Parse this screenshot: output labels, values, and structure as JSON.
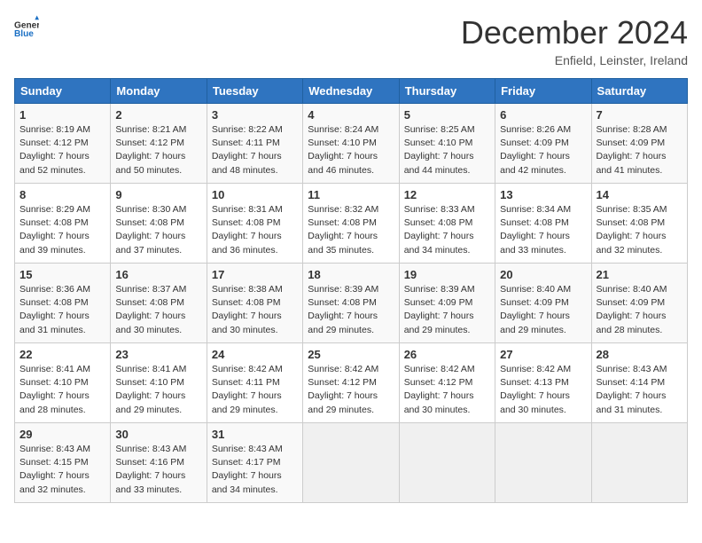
{
  "logo": {
    "general": "General",
    "blue": "Blue"
  },
  "title": "December 2024",
  "location": "Enfield, Leinster, Ireland",
  "days_of_week": [
    "Sunday",
    "Monday",
    "Tuesday",
    "Wednesday",
    "Thursday",
    "Friday",
    "Saturday"
  ],
  "weeks": [
    [
      {
        "day": "1",
        "sunrise": "8:19 AM",
        "sunset": "4:12 PM",
        "daylight": "7 hours and 52 minutes."
      },
      {
        "day": "2",
        "sunrise": "8:21 AM",
        "sunset": "4:12 PM",
        "daylight": "7 hours and 50 minutes."
      },
      {
        "day": "3",
        "sunrise": "8:22 AM",
        "sunset": "4:11 PM",
        "daylight": "7 hours and 48 minutes."
      },
      {
        "day": "4",
        "sunrise": "8:24 AM",
        "sunset": "4:10 PM",
        "daylight": "7 hours and 46 minutes."
      },
      {
        "day": "5",
        "sunrise": "8:25 AM",
        "sunset": "4:10 PM",
        "daylight": "7 hours and 44 minutes."
      },
      {
        "day": "6",
        "sunrise": "8:26 AM",
        "sunset": "4:09 PM",
        "daylight": "7 hours and 42 minutes."
      },
      {
        "day": "7",
        "sunrise": "8:28 AM",
        "sunset": "4:09 PM",
        "daylight": "7 hours and 41 minutes."
      }
    ],
    [
      {
        "day": "8",
        "sunrise": "8:29 AM",
        "sunset": "4:08 PM",
        "daylight": "7 hours and 39 minutes."
      },
      {
        "day": "9",
        "sunrise": "8:30 AM",
        "sunset": "4:08 PM",
        "daylight": "7 hours and 37 minutes."
      },
      {
        "day": "10",
        "sunrise": "8:31 AM",
        "sunset": "4:08 PM",
        "daylight": "7 hours and 36 minutes."
      },
      {
        "day": "11",
        "sunrise": "8:32 AM",
        "sunset": "4:08 PM",
        "daylight": "7 hours and 35 minutes."
      },
      {
        "day": "12",
        "sunrise": "8:33 AM",
        "sunset": "4:08 PM",
        "daylight": "7 hours and 34 minutes."
      },
      {
        "day": "13",
        "sunrise": "8:34 AM",
        "sunset": "4:08 PM",
        "daylight": "7 hours and 33 minutes."
      },
      {
        "day": "14",
        "sunrise": "8:35 AM",
        "sunset": "4:08 PM",
        "daylight": "7 hours and 32 minutes."
      }
    ],
    [
      {
        "day": "15",
        "sunrise": "8:36 AM",
        "sunset": "4:08 PM",
        "daylight": "7 hours and 31 minutes."
      },
      {
        "day": "16",
        "sunrise": "8:37 AM",
        "sunset": "4:08 PM",
        "daylight": "7 hours and 30 minutes."
      },
      {
        "day": "17",
        "sunrise": "8:38 AM",
        "sunset": "4:08 PM",
        "daylight": "7 hours and 30 minutes."
      },
      {
        "day": "18",
        "sunrise": "8:39 AM",
        "sunset": "4:08 PM",
        "daylight": "7 hours and 29 minutes."
      },
      {
        "day": "19",
        "sunrise": "8:39 AM",
        "sunset": "4:09 PM",
        "daylight": "7 hours and 29 minutes."
      },
      {
        "day": "20",
        "sunrise": "8:40 AM",
        "sunset": "4:09 PM",
        "daylight": "7 hours and 29 minutes."
      },
      {
        "day": "21",
        "sunrise": "8:40 AM",
        "sunset": "4:09 PM",
        "daylight": "7 hours and 28 minutes."
      }
    ],
    [
      {
        "day": "22",
        "sunrise": "8:41 AM",
        "sunset": "4:10 PM",
        "daylight": "7 hours and 28 minutes."
      },
      {
        "day": "23",
        "sunrise": "8:41 AM",
        "sunset": "4:10 PM",
        "daylight": "7 hours and 29 minutes."
      },
      {
        "day": "24",
        "sunrise": "8:42 AM",
        "sunset": "4:11 PM",
        "daylight": "7 hours and 29 minutes."
      },
      {
        "day": "25",
        "sunrise": "8:42 AM",
        "sunset": "4:12 PM",
        "daylight": "7 hours and 29 minutes."
      },
      {
        "day": "26",
        "sunrise": "8:42 AM",
        "sunset": "4:12 PM",
        "daylight": "7 hours and 30 minutes."
      },
      {
        "day": "27",
        "sunrise": "8:42 AM",
        "sunset": "4:13 PM",
        "daylight": "7 hours and 30 minutes."
      },
      {
        "day": "28",
        "sunrise": "8:43 AM",
        "sunset": "4:14 PM",
        "daylight": "7 hours and 31 minutes."
      }
    ],
    [
      {
        "day": "29",
        "sunrise": "8:43 AM",
        "sunset": "4:15 PM",
        "daylight": "7 hours and 32 minutes."
      },
      {
        "day": "30",
        "sunrise": "8:43 AM",
        "sunset": "4:16 PM",
        "daylight": "7 hours and 33 minutes."
      },
      {
        "day": "31",
        "sunrise": "8:43 AM",
        "sunset": "4:17 PM",
        "daylight": "7 hours and 34 minutes."
      },
      null,
      null,
      null,
      null
    ]
  ]
}
